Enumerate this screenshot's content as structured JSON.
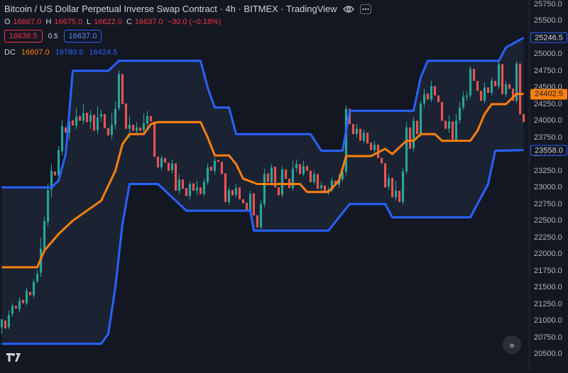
{
  "header": {
    "title": "Bitcoin / US Dollar Perpetual Inverse Swap Contract · 4h · BITMEX · TradingView",
    "ohlc": {
      "o_label": "O",
      "o": "16667.0",
      "h_label": "H",
      "h": "16675.0",
      "l_label": "L",
      "l": "16622.0",
      "c_label": "C",
      "c": "16637.0",
      "change": "−30.0 (−0.18%)"
    },
    "bid": "16636.5",
    "spread": "0.5",
    "ask": "16637.0",
    "indicator": {
      "name": "DC",
      "basis": "16607.0",
      "upper": "16789.5",
      "lower": "16424.5"
    }
  },
  "price_tags": {
    "upper": "25246.5",
    "basis": "24402.5",
    "lower": "23558.0"
  },
  "colors": {
    "background": "#131722",
    "up": "#26a69a",
    "down": "#ef5350",
    "band": "#2962ff",
    "basis": "#ff7f0e",
    "fill": "#1b2333"
  },
  "chart_data": {
    "type": "candlestick",
    "indicator": "Donchian Channels",
    "ylim": [
      20500,
      25750
    ],
    "y_ticks": [
      "25750.0",
      "25500.0",
      "25250.0",
      "25000.0",
      "24750.0",
      "24500.0",
      "24250.0",
      "24000.0",
      "23750.0",
      "23500.0",
      "23250.0",
      "23000.0",
      "22750.0",
      "22500.0",
      "22250.0",
      "22000.0",
      "21750.0",
      "21500.0",
      "21250.0",
      "21000.0",
      "20750.0",
      "20500.0"
    ],
    "x_range": [
      0,
      148
    ],
    "upper_band": [
      [
        0,
        23000
      ],
      [
        14,
        23000
      ],
      [
        16,
        23100
      ],
      [
        18,
        23500
      ],
      [
        20,
        24750
      ],
      [
        30,
        24750
      ],
      [
        33,
        24900
      ],
      [
        56,
        24900
      ],
      [
        58,
        24500
      ],
      [
        60,
        24200
      ],
      [
        64,
        24200
      ],
      [
        66,
        23800
      ],
      [
        87,
        23800
      ],
      [
        90,
        23550
      ],
      [
        96,
        23550
      ],
      [
        98,
        24150
      ],
      [
        116,
        24150
      ],
      [
        118,
        24650
      ],
      [
        120,
        24900
      ],
      [
        140,
        24900
      ],
      [
        142,
        25100
      ],
      [
        147,
        25246.5
      ]
    ],
    "lower_band": [
      [
        0,
        20650
      ],
      [
        28,
        20650
      ],
      [
        30,
        20800
      ],
      [
        32,
        21500
      ],
      [
        34,
        22450
      ],
      [
        36,
        23050
      ],
      [
        44,
        23050
      ],
      [
        46,
        22950
      ],
      [
        48,
        22850
      ],
      [
        52,
        22650
      ],
      [
        70,
        22650
      ],
      [
        71,
        22350
      ],
      [
        92,
        22350
      ],
      [
        95,
        22550
      ],
      [
        98,
        22750
      ],
      [
        108,
        22750
      ],
      [
        110,
        22550
      ],
      [
        132,
        22550
      ],
      [
        135,
        22850
      ],
      [
        137,
        23050
      ],
      [
        139,
        23550
      ],
      [
        147,
        23558
      ]
    ],
    "basis": [
      [
        0,
        21800
      ],
      [
        10,
        21800
      ],
      [
        12,
        22050
      ],
      [
        16,
        22300
      ],
      [
        20,
        22500
      ],
      [
        28,
        22800
      ],
      [
        32,
        23250
      ],
      [
        34,
        23650
      ],
      [
        36,
        23800
      ],
      [
        40,
        23800
      ],
      [
        42,
        23950
      ],
      [
        44,
        23980
      ],
      [
        56,
        23980
      ],
      [
        58,
        23750
      ],
      [
        60,
        23480
      ],
      [
        64,
        23480
      ],
      [
        66,
        23350
      ],
      [
        68,
        23130
      ],
      [
        72,
        23050
      ],
      [
        84,
        23050
      ],
      [
        86,
        22930
      ],
      [
        92,
        22930
      ],
      [
        95,
        23100
      ],
      [
        97,
        23470
      ],
      [
        104,
        23470
      ],
      [
        108,
        23580
      ],
      [
        110,
        23500
      ],
      [
        114,
        23700
      ],
      [
        116,
        23700
      ],
      [
        118,
        23800
      ],
      [
        122,
        23800
      ],
      [
        124,
        23700
      ],
      [
        132,
        23700
      ],
      [
        134,
        23850
      ],
      [
        136,
        24100
      ],
      [
        138,
        24250
      ],
      [
        142,
        24250
      ],
      [
        145,
        24402.5
      ],
      [
        147,
        24402.5
      ]
    ],
    "candles": [
      [
        0,
        20900,
        21020,
        20800,
        20750
      ],
      [
        1,
        21000,
        20880,
        21060,
        20830
      ],
      [
        2,
        20900,
        21080,
        20870,
        21150
      ],
      [
        3,
        21100,
        21220,
        21060,
        21260
      ],
      [
        4,
        21220,
        21180,
        21290,
        21130
      ],
      [
        5,
        21170,
        21300,
        21120,
        21350
      ],
      [
        6,
        21310,
        21260,
        21380,
        21200
      ],
      [
        7,
        21260,
        21450,
        21230,
        21500
      ],
      [
        8,
        21430,
        21380,
        21490,
        21330
      ],
      [
        9,
        21380,
        21580,
        21340,
        21620
      ],
      [
        10,
        21590,
        21700,
        21560,
        21760
      ],
      [
        11,
        21720,
        22080,
        21650,
        22240
      ],
      [
        12,
        22070,
        22490,
        22030,
        22560
      ],
      [
        13,
        22480,
        22960,
        22420,
        23060
      ],
      [
        14,
        22970,
        23250,
        22850,
        23350
      ],
      [
        15,
        23240,
        23180,
        23330,
        23050
      ],
      [
        16,
        23180,
        23560,
        23080,
        23620
      ],
      [
        17,
        23540,
        23920,
        23480,
        24020
      ],
      [
        18,
        23900,
        23820,
        24090,
        23760
      ],
      [
        19,
        23820,
        23990,
        23720,
        24260
      ],
      [
        20,
        24010,
        23930,
        24080,
        23840
      ],
      [
        21,
        23930,
        24060,
        23870,
        24190
      ],
      [
        22,
        24070,
        24000,
        24150,
        23900
      ],
      [
        23,
        24000,
        24110,
        23950,
        24250
      ],
      [
        24,
        24120,
        23980,
        24190,
        23900
      ],
      [
        25,
        23990,
        24080,
        23880,
        24160
      ],
      [
        26,
        24090,
        23850,
        24130,
        23780
      ],
      [
        27,
        23860,
        24050,
        23800,
        24220
      ],
      [
        28,
        24060,
        24100,
        23990,
        24170
      ],
      [
        29,
        24100,
        23890,
        24150,
        23780
      ],
      [
        30,
        23890,
        23780,
        23960,
        23620
      ],
      [
        31,
        23790,
        23940,
        23720,
        24120
      ],
      [
        32,
        23940,
        24180,
        23880,
        24290
      ],
      [
        33,
        24190,
        24700,
        24150,
        24760
      ],
      [
        34,
        24700,
        24250,
        24760,
        24200
      ],
      [
        35,
        24260,
        23880,
        24320,
        23850
      ],
      [
        36,
        23880,
        23940,
        23740,
        24080
      ],
      [
        37,
        23940,
        23850,
        24050,
        23780
      ],
      [
        38,
        23850,
        23900,
        23800,
        23980
      ],
      [
        39,
        23900,
        23850,
        23940,
        23800
      ],
      [
        40,
        23860,
        23960,
        23810,
        24110
      ],
      [
        41,
        23960,
        24070,
        23900,
        24150
      ],
      [
        42,
        24070,
        23990,
        24140,
        23940
      ],
      [
        43,
        23990,
        23460,
        24040,
        23380
      ],
      [
        44,
        23460,
        23300,
        23510,
        23230
      ],
      [
        45,
        23300,
        23440,
        23250,
        23480
      ],
      [
        46,
        23440,
        23370,
        23480,
        23320
      ],
      [
        47,
        23370,
        23250,
        23400,
        23180
      ],
      [
        48,
        23260,
        23360,
        23210,
        23420
      ],
      [
        49,
        23360,
        22950,
        23400,
        22880
      ],
      [
        50,
        22950,
        23120,
        22900,
        23200
      ],
      [
        51,
        23120,
        22980,
        23150,
        22930
      ],
      [
        52,
        22990,
        22870,
        23020,
        22800
      ],
      [
        53,
        22870,
        23050,
        22820,
        23080
      ],
      [
        54,
        23060,
        22950,
        23120,
        22900
      ],
      [
        55,
        22950,
        23000,
        22880,
        23100
      ],
      [
        56,
        23000,
        22900,
        23050,
        22850
      ],
      [
        57,
        22900,
        23080,
        22870,
        23130
      ],
      [
        58,
        23080,
        23300,
        23040,
        23360
      ],
      [
        59,
        23310,
        23250,
        23350,
        23200
      ],
      [
        60,
        23250,
        23400,
        23190,
        23450
      ],
      [
        61,
        23410,
        23380,
        23440,
        23330
      ],
      [
        62,
        23380,
        23200,
        23420,
        23150
      ],
      [
        63,
        23210,
        22780,
        23240,
        22720
      ],
      [
        64,
        22780,
        22960,
        22740,
        23000
      ],
      [
        65,
        22960,
        22880,
        23010,
        22830
      ],
      [
        66,
        22890,
        22990,
        22850,
        23050
      ],
      [
        67,
        23000,
        22820,
        23030,
        22780
      ],
      [
        68,
        22820,
        22760,
        22880,
        22700
      ],
      [
        69,
        22770,
        22650,
        22800,
        22600
      ],
      [
        70,
        22650,
        22900,
        22610,
        22950
      ],
      [
        71,
        22910,
        22580,
        22940,
        22480
      ],
      [
        72,
        22580,
        22400,
        22640,
        22360
      ],
      [
        73,
        22400,
        22750,
        22380,
        22800
      ],
      [
        74,
        22750,
        23200,
        22700,
        23280
      ],
      [
        75,
        23210,
        23080,
        23260,
        23030
      ],
      [
        76,
        23080,
        23300,
        23030,
        23350
      ],
      [
        77,
        23310,
        23000,
        23340,
        22900
      ],
      [
        78,
        23000,
        22880,
        23080,
        22830
      ],
      [
        79,
        22890,
        23270,
        22850,
        23320
      ],
      [
        80,
        23270,
        23130,
        23320,
        23080
      ],
      [
        81,
        23130,
        22990,
        23180,
        22930
      ],
      [
        82,
        22990,
        23280,
        22950,
        23400
      ],
      [
        83,
        23290,
        23350,
        23230,
        23420
      ],
      [
        84,
        23350,
        23200,
        23380,
        23130
      ],
      [
        85,
        23200,
        23320,
        23170,
        23400
      ],
      [
        86,
        23320,
        23250,
        23350,
        23200
      ],
      [
        87,
        23250,
        23080,
        23300,
        23030
      ],
      [
        88,
        23080,
        23200,
        23040,
        23250
      ],
      [
        89,
        23200,
        22980,
        23240,
        22930
      ],
      [
        90,
        22990,
        23030,
        22930,
        23080
      ],
      [
        91,
        23030,
        22920,
        23070,
        22880
      ],
      [
        92,
        22920,
        22960,
        22880,
        23010
      ],
      [
        93,
        22960,
        23100,
        22930,
        23150
      ],
      [
        94,
        23100,
        23040,
        23130,
        22990
      ],
      [
        95,
        23040,
        23120,
        22990,
        23200
      ],
      [
        96,
        23120,
        23230,
        23080,
        23300
      ],
      [
        97,
        23230,
        24180,
        23180,
        24230
      ],
      [
        98,
        24180,
        23950,
        24210,
        23880
      ],
      [
        99,
        23950,
        23800,
        24040,
        23720
      ],
      [
        100,
        23800,
        23880,
        23750,
        23950
      ],
      [
        101,
        23880,
        23700,
        23930,
        23640
      ],
      [
        102,
        23700,
        23820,
        23660,
        23870
      ],
      [
        103,
        23820,
        23660,
        23860,
        23600
      ],
      [
        104,
        23670,
        23560,
        23700,
        23500
      ],
      [
        105,
        23560,
        23640,
        23520,
        23700
      ],
      [
        106,
        23640,
        23440,
        23680,
        23380
      ],
      [
        107,
        23440,
        23360,
        23480,
        23300
      ],
      [
        108,
        23360,
        23000,
        23400,
        22930
      ],
      [
        109,
        23010,
        23140,
        22960,
        23200
      ],
      [
        110,
        23140,
        22850,
        23180,
        22800
      ],
      [
        111,
        22850,
        22950,
        22800,
        23100
      ],
      [
        112,
        22950,
        22780,
        23000,
        22700
      ],
      [
        113,
        22780,
        23240,
        22740,
        23300
      ],
      [
        114,
        23240,
        23900,
        23200,
        23980
      ],
      [
        115,
        23900,
        23580,
        23950,
        23500
      ],
      [
        116,
        23590,
        24000,
        23540,
        24050
      ],
      [
        117,
        24000,
        23800,
        24050,
        23750
      ],
      [
        118,
        23810,
        24260,
        23760,
        24300
      ],
      [
        119,
        24260,
        24400,
        24200,
        24480
      ],
      [
        120,
        24410,
        24320,
        24450,
        24250
      ],
      [
        121,
        24320,
        24520,
        24280,
        24600
      ],
      [
        122,
        24520,
        24380,
        24560,
        24330
      ],
      [
        123,
        24380,
        24280,
        24420,
        24220
      ],
      [
        124,
        24280,
        24000,
        24320,
        23960
      ],
      [
        125,
        24000,
        23880,
        24080,
        23820
      ],
      [
        126,
        23880,
        23990,
        23820,
        24080
      ],
      [
        127,
        23990,
        23720,
        24040,
        23660
      ],
      [
        128,
        23720,
        24000,
        23680,
        24100
      ],
      [
        129,
        24010,
        24200,
        23960,
        24280
      ],
      [
        130,
        24200,
        24360,
        24160,
        24440
      ],
      [
        131,
        24360,
        24380,
        24300,
        24450
      ],
      [
        132,
        24380,
        24780,
        24340,
        24820
      ],
      [
        133,
        24780,
        24600,
        24820,
        24550
      ],
      [
        134,
        24600,
        24450,
        24640,
        24400
      ],
      [
        135,
        24450,
        24300,
        24500,
        24250
      ],
      [
        136,
        24300,
        24500,
        24260,
        24580
      ],
      [
        137,
        24500,
        24420,
        24540,
        24380
      ],
      [
        138,
        24420,
        24600,
        24380,
        24650
      ],
      [
        139,
        24600,
        24520,
        24640,
        24480
      ],
      [
        140,
        24520,
        24850,
        24480,
        24900
      ],
      [
        141,
        24850,
        24400,
        24880,
        24350
      ],
      [
        142,
        24400,
        24550,
        24360,
        24600
      ],
      [
        143,
        24550,
        24480,
        24600,
        24420
      ],
      [
        144,
        24480,
        24300,
        24520,
        24250
      ],
      [
        145,
        24300,
        24860,
        24260,
        24900
      ],
      [
        146,
        24860,
        24100,
        24920,
        24050
      ],
      [
        147,
        24100,
        23980,
        24150,
        23920
      ]
    ]
  }
}
